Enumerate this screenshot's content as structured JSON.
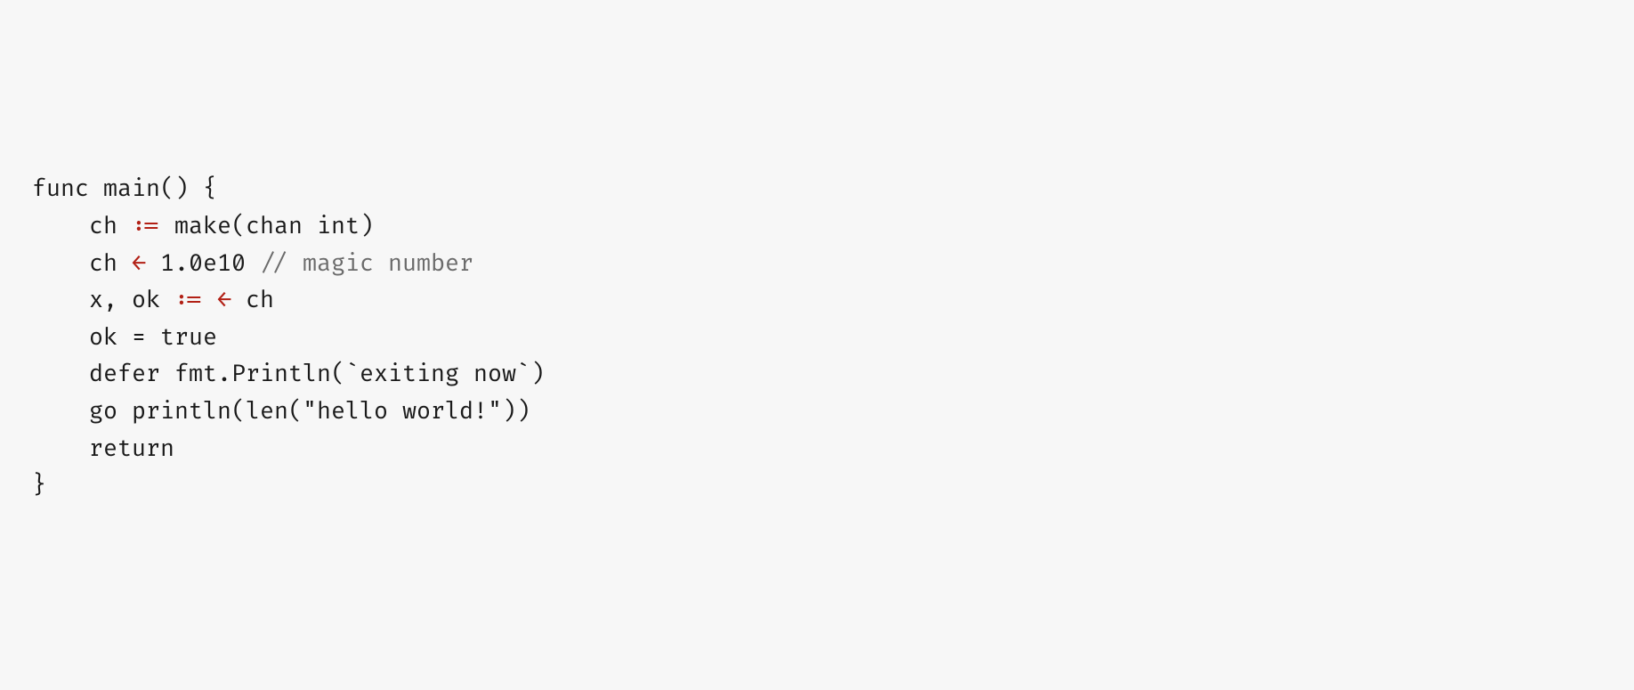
{
  "code": {
    "lines": [
      {
        "indent": 0,
        "segments": [
          {
            "text": "func main() {",
            "cls": ""
          }
        ]
      },
      {
        "indent": 1,
        "segments": [
          {
            "text": "ch ",
            "cls": ""
          },
          {
            "text": ":=",
            "cls": "op"
          },
          {
            "text": " make(chan int)",
            "cls": ""
          }
        ]
      },
      {
        "indent": 1,
        "segments": [
          {
            "text": "ch ",
            "cls": ""
          },
          {
            "text": "←",
            "cls": "op"
          },
          {
            "text": " 1.0e10 ",
            "cls": ""
          },
          {
            "text": "// magic number",
            "cls": "comment"
          }
        ]
      },
      {
        "indent": 1,
        "segments": [
          {
            "text": "x, ok ",
            "cls": ""
          },
          {
            "text": ":=",
            "cls": "op"
          },
          {
            "text": " ",
            "cls": ""
          },
          {
            "text": "←",
            "cls": "op"
          },
          {
            "text": " ch",
            "cls": ""
          }
        ]
      },
      {
        "indent": 1,
        "segments": [
          {
            "text": "ok = true",
            "cls": ""
          }
        ]
      },
      {
        "indent": 1,
        "segments": [
          {
            "text": "defer fmt.Println(`exiting now`)",
            "cls": ""
          }
        ]
      },
      {
        "indent": 1,
        "segments": [
          {
            "text": "go println(len(\"hello world!\"))",
            "cls": ""
          }
        ]
      },
      {
        "indent": 1,
        "segments": [
          {
            "text": "return",
            "cls": ""
          }
        ]
      },
      {
        "indent": 0,
        "segments": [
          {
            "text": "}",
            "cls": ""
          }
        ]
      }
    ],
    "indent_unit": "    "
  }
}
